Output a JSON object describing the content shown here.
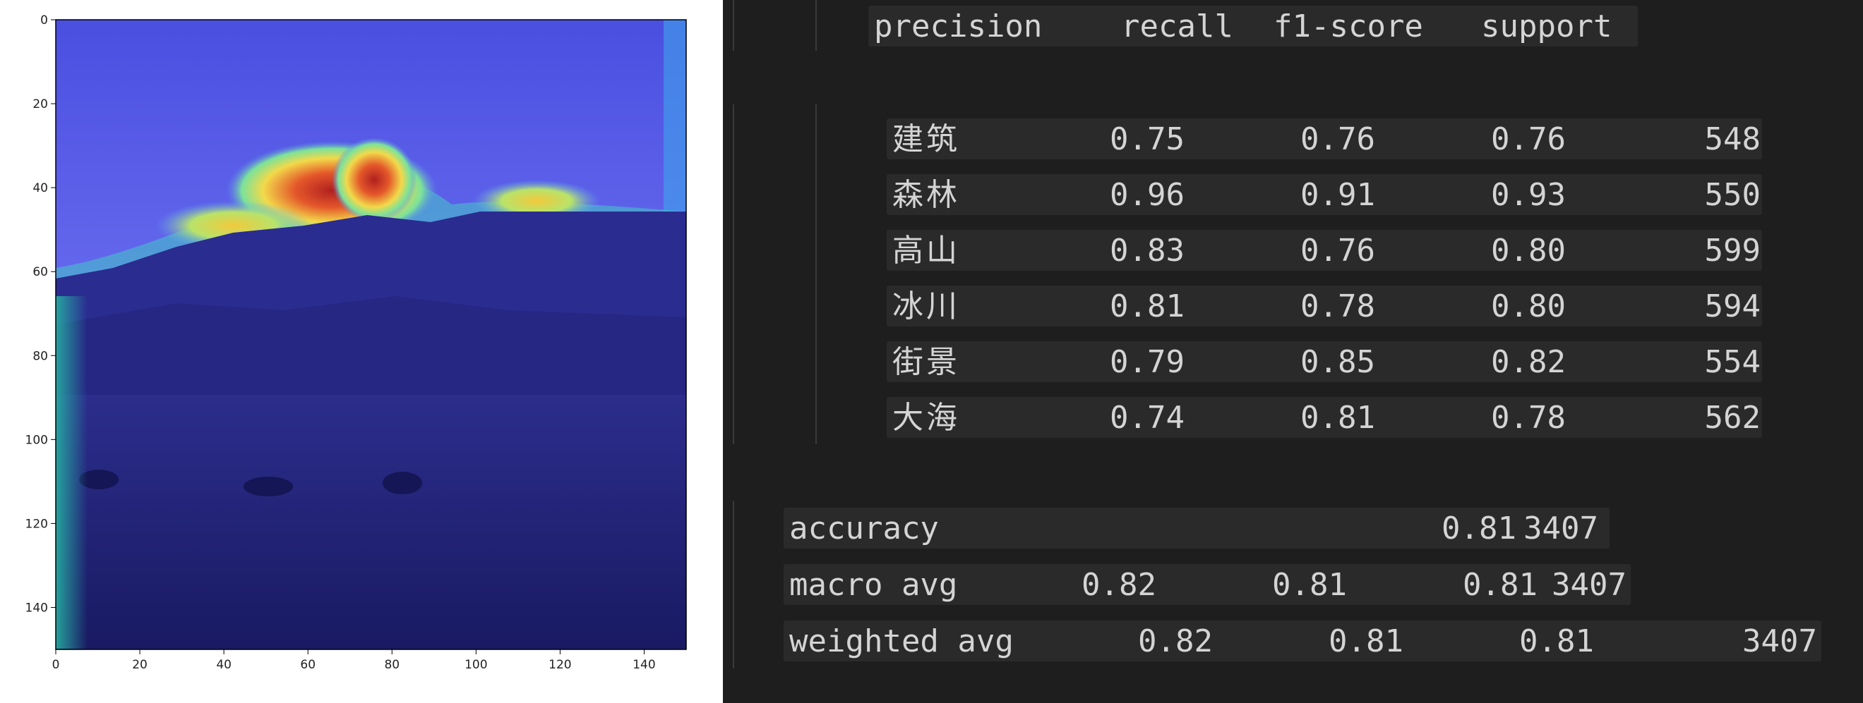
{
  "plot": {
    "x_ticks": [
      "0",
      "20",
      "40",
      "60",
      "80",
      "100",
      "120",
      "140"
    ],
    "y_ticks": [
      "0",
      "20",
      "40",
      "60",
      "80",
      "100",
      "120",
      "140"
    ],
    "x_range": [
      0,
      150
    ],
    "y_range": [
      0,
      150
    ],
    "colormap": "jet",
    "colors": {
      "sky": "#5a5ce6",
      "mountain": "#2a2a8a",
      "ground": "#1e1f70",
      "hot_red": "#c0282a",
      "hot_yellow": "#f4e04a",
      "cyan_edge": "#2ab2a6"
    }
  },
  "report": {
    "headers": [
      "precision",
      "recall",
      "f1-score",
      "support"
    ],
    "classes": [
      {
        "label": "建筑",
        "precision": "0.75",
        "recall": "0.76",
        "f1": "0.76",
        "support": "548"
      },
      {
        "label": "森林",
        "precision": "0.96",
        "recall": "0.91",
        "f1": "0.93",
        "support": "550"
      },
      {
        "label": "高山",
        "precision": "0.83",
        "recall": "0.76",
        "f1": "0.80",
        "support": "599"
      },
      {
        "label": "冰川",
        "precision": "0.81",
        "recall": "0.78",
        "f1": "0.80",
        "support": "594"
      },
      {
        "label": "街景",
        "precision": "0.79",
        "recall": "0.85",
        "f1": "0.82",
        "support": "554"
      },
      {
        "label": "大海",
        "precision": "0.74",
        "recall": "0.81",
        "f1": "0.78",
        "support": "562"
      }
    ],
    "accuracy": {
      "label": "accuracy",
      "f1": "0.81",
      "support": "3407"
    },
    "macro_avg": {
      "label": "macro avg",
      "precision": "0.82",
      "recall": "0.81",
      "f1": "0.81",
      "support": "3407"
    },
    "weighted_avg": {
      "label": "weighted avg",
      "precision": "0.82",
      "recall": "0.81",
      "f1": "0.81",
      "support": "3407"
    },
    "colors": {
      "background": "#1e1e1e",
      "row_highlight": "#2a2a2a",
      "text": "#d4d4d4"
    }
  }
}
